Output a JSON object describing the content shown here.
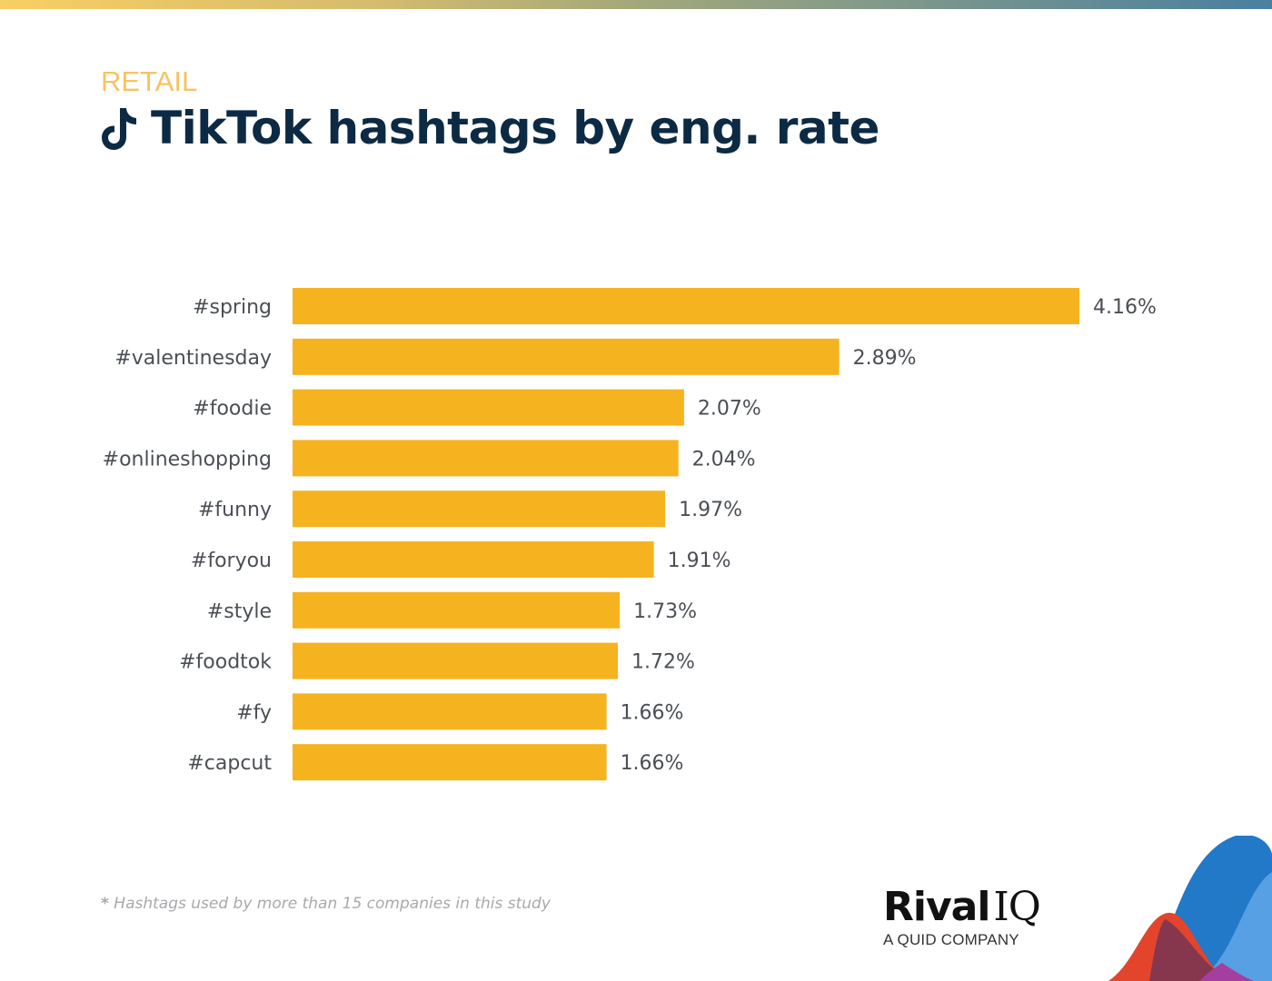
{
  "header": {
    "category": "RETAIL",
    "title": "TikTok hashtags by eng. rate",
    "icon": "tiktok-icon"
  },
  "footnote": {
    "marker": "*",
    "text": " Hashtags used by more than 15 companies in this study"
  },
  "branding": {
    "logo_main": "Rival",
    "logo_iq": "IQ",
    "logo_sub": "A QUID COMPANY"
  },
  "colors": {
    "bar": "#f5b31f",
    "title": "#0c2a43",
    "category": "#f5c462",
    "label": "#4b4f55",
    "footnote": "#a7a9ac"
  },
  "chart_data": {
    "type": "bar",
    "orientation": "horizontal",
    "title": "TikTok hashtags by eng. rate",
    "xlabel": "",
    "ylabel": "",
    "categories": [
      "#spring",
      "#valentinesday",
      "#foodie",
      "#onlineshopping",
      "#funny",
      "#foryou",
      "#style",
      "#foodtok",
      "#fy",
      "#capcut"
    ],
    "values": [
      4.16,
      2.89,
      2.07,
      2.04,
      1.97,
      1.91,
      1.73,
      1.72,
      1.66,
      1.66
    ],
    "value_labels": [
      "4.16%",
      "2.89%",
      "2.07%",
      "2.04%",
      "1.97%",
      "1.91%",
      "1.73%",
      "1.72%",
      "1.66%",
      "1.66%"
    ],
    "unit": "%",
    "xlim": [
      0,
      4.16
    ],
    "grid": false,
    "legend": "none"
  }
}
